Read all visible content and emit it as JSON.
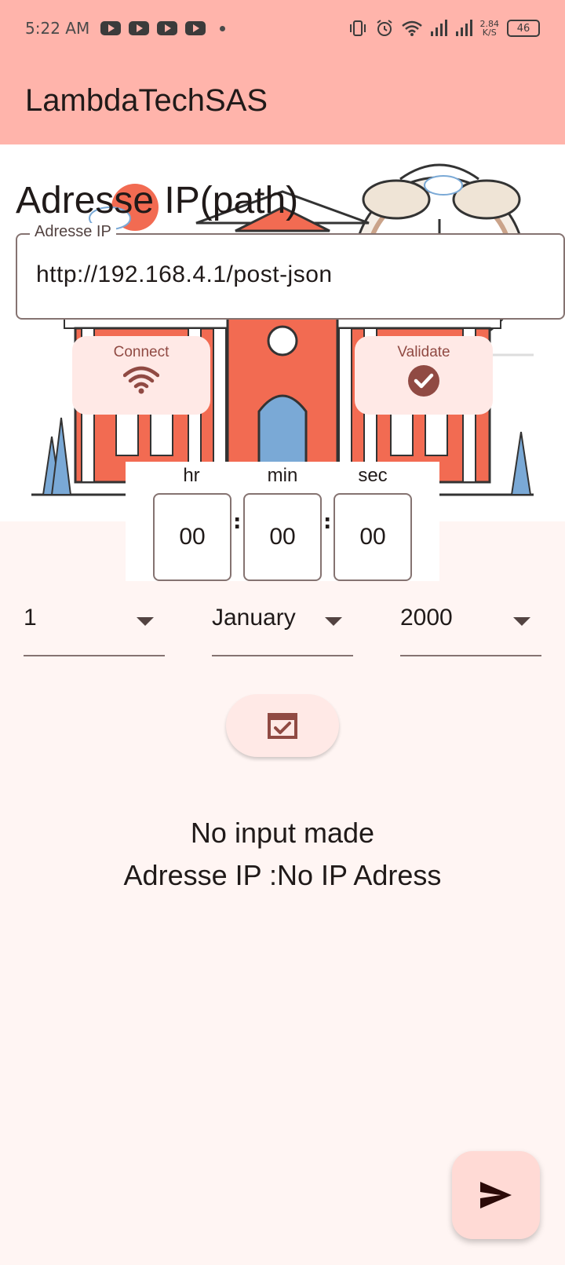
{
  "status_bar": {
    "time": "5:22 AM",
    "net_speed_value": "2.84",
    "net_speed_unit": "K/S",
    "battery": "46"
  },
  "app_bar": {
    "title": "LambdaTechSAS"
  },
  "ip_section": {
    "title": "Adresse IP(path)",
    "field_label": "Adresse IP",
    "field_value": "http://192.168.4.1/post-json"
  },
  "actions": {
    "connect_label": "Connect",
    "validate_label": "Validate"
  },
  "time": {
    "hr_label": "hr",
    "min_label": "min",
    "sec_label": "sec",
    "hr_value": "00",
    "min_value": "00",
    "sec_value": "00",
    "separator": ":"
  },
  "date": {
    "day": "1",
    "month": "January",
    "year": "2000"
  },
  "result": {
    "line1": "No input made",
    "line2": "Adresse IP :No IP Adress"
  },
  "colors": {
    "app_bar": "#ffb4ab",
    "card": "#ffe9e6",
    "accent": "#904a43",
    "fab": "#ffdad5",
    "background": "#fff5f3"
  }
}
